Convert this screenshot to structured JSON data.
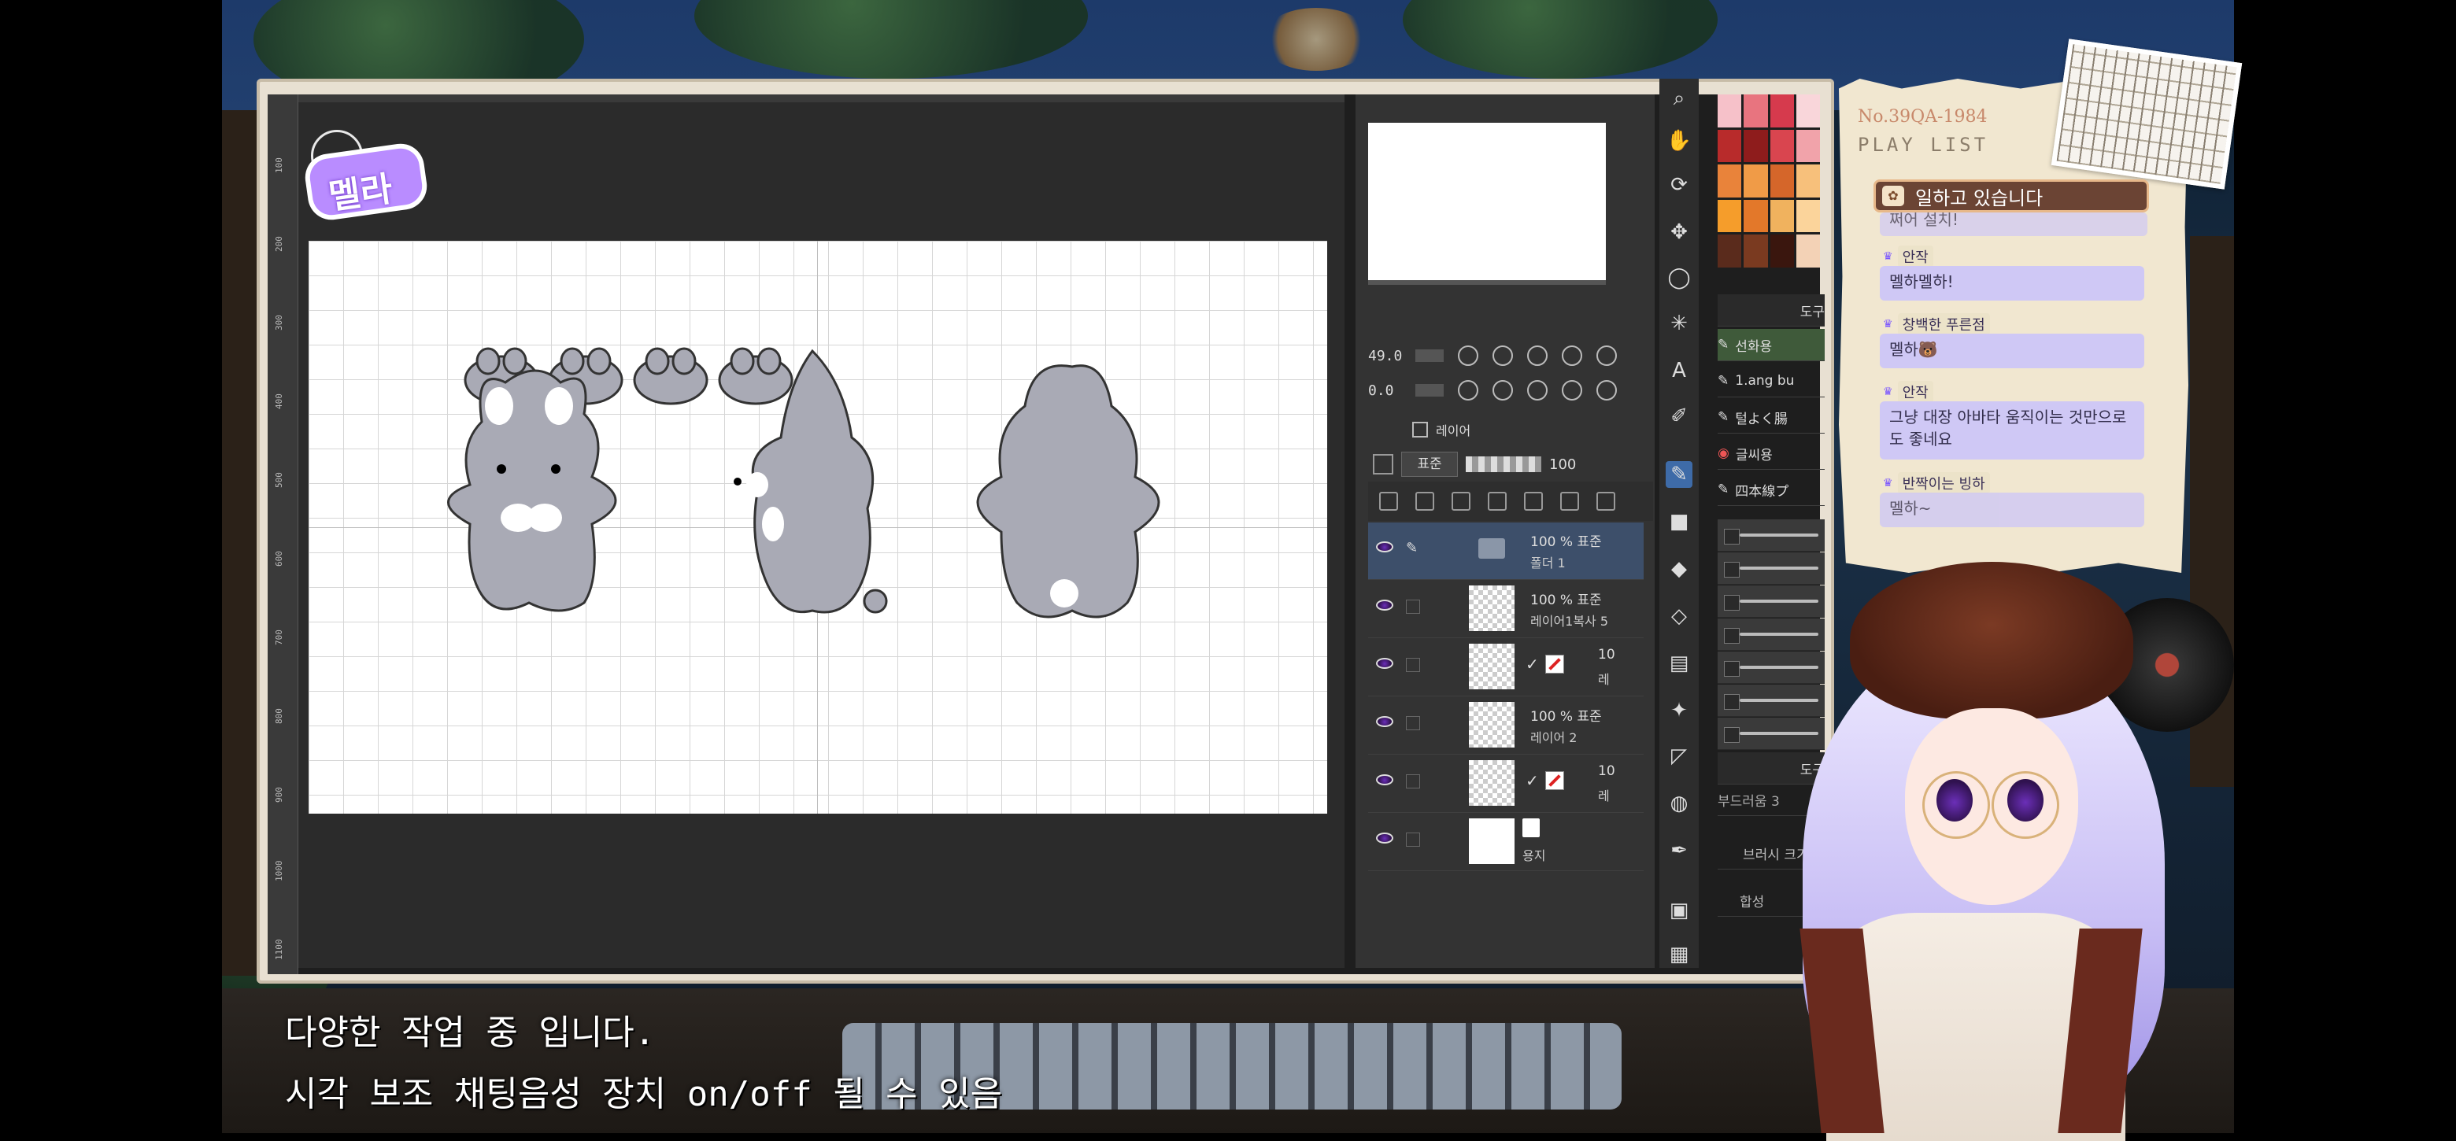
{
  "app": {
    "title": "",
    "canvas_rulers": [
      "1100",
      "1000",
      "900",
      "800",
      "700",
      "600",
      "500",
      "400",
      "300",
      "200",
      "100"
    ]
  },
  "logo": {
    "text": "멜라"
  },
  "navigator": {
    "zoom": "49.0",
    "rotation": "0.0"
  },
  "layer_panel": {
    "tab_label": "레이어",
    "blend_mode": "표준",
    "opacity": "100",
    "layers": [
      {
        "line1": "100 % 표준",
        "line2": "폴더 1",
        "selected": true
      },
      {
        "line1": "100 % 표준",
        "line2": "레이어1복사 5",
        "selected": false
      },
      {
        "line1": "10",
        "line2": "레",
        "selected": false,
        "marked": true
      },
      {
        "line1": "100 % 표준",
        "line2": "레이어 2",
        "selected": false
      },
      {
        "line1": "10",
        "line2": "레",
        "selected": false,
        "marked": true
      },
      {
        "line1": "",
        "line2": "용지",
        "selected": false,
        "paper": true
      }
    ]
  },
  "subtools": {
    "header": "도구",
    "items": [
      "선화용",
      "1.ang bu",
      "털よく腸",
      "글씨용",
      "四本線プ"
    ],
    "brush_header": "도구",
    "brush_name": "부드러움 3",
    "brush_size_label": "브러시 크기",
    "blend_label": "합성"
  },
  "palette": [
    "#f6c1c9",
    "#e8747f",
    "#d63a4d",
    "#f9d6da",
    "#b82b2b",
    "#8e1c1c",
    "#d9454f",
    "#f1a3aa",
    "#e9833a",
    "#f09b47",
    "#d5662a",
    "#f7c07b",
    "#f59d2b",
    "#e3782a",
    "#f0b25e",
    "#fbd49b",
    "#5a2b1c",
    "#7a3a20",
    "#3a160e",
    "#f3d2b6"
  ],
  "playlist": {
    "code": "No.39QA-1984",
    "title": "PLAY LIST",
    "header_icon": "paw",
    "header": "일하고 있습니다",
    "messages": [
      {
        "name": "",
        "text": "쩌어 설치!",
        "partial": true
      },
      {
        "name": "안작",
        "text": "멜하멜하!"
      },
      {
        "name": "창백한 푸른점",
        "text": "멜하🐻"
      },
      {
        "name": "안작",
        "text": "그냥 대장 아바타 움직이는 것만으로도 좋네요"
      },
      {
        "name": "반짝이는 빙하",
        "text": "멜하~"
      }
    ]
  },
  "subtitles": {
    "line1": "다양한 작업 중 입니다.",
    "line2": "시각 보조 채팅음성 장치 on/off 될 수 있음"
  }
}
